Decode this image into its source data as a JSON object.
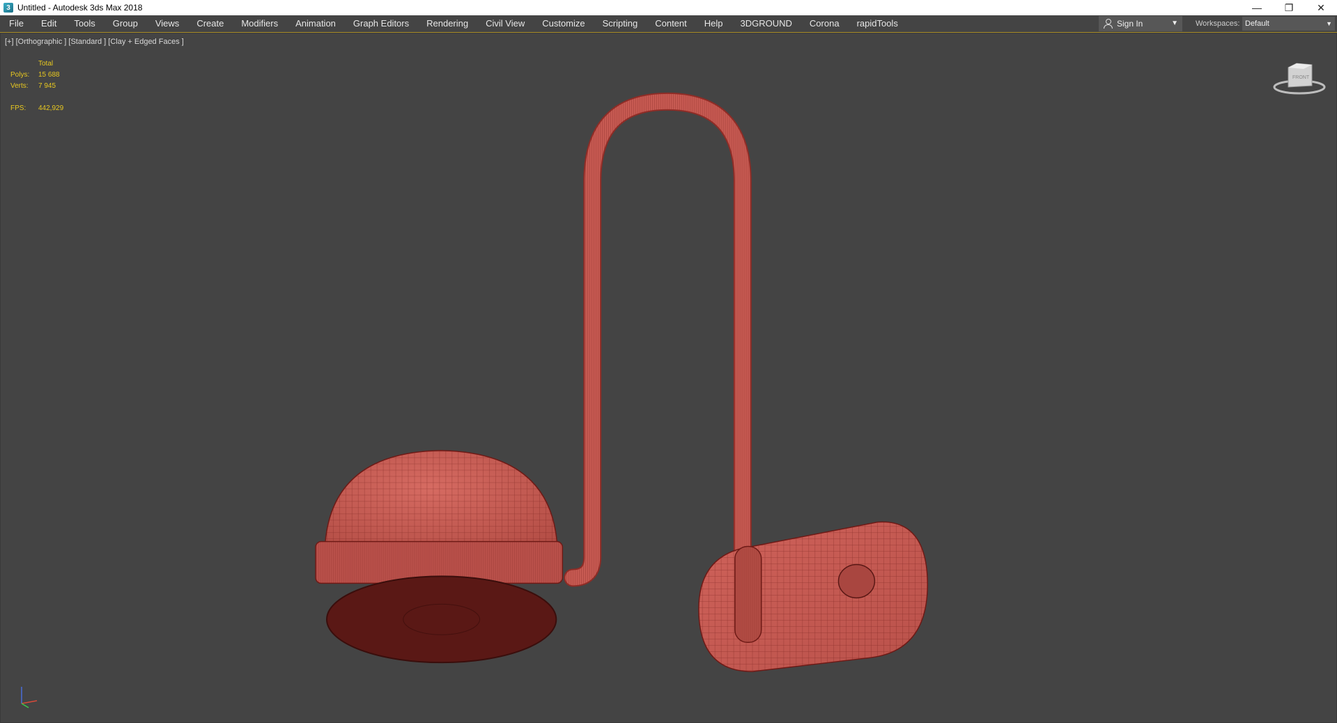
{
  "window": {
    "title": "Untitled - Autodesk 3ds Max 2018",
    "icon": "3dsmax-app-icon",
    "controls": [
      "minimize-icon",
      "restore-icon",
      "close-icon"
    ],
    "glyphs": {
      "minimize": "—",
      "restore": "❐",
      "close": "✕"
    }
  },
  "menu": {
    "items": [
      "File",
      "Edit",
      "Tools",
      "Group",
      "Views",
      "Create",
      "Modifiers",
      "Animation",
      "Graph Editors",
      "Rendering",
      "Civil View",
      "Customize",
      "Scripting",
      "Content",
      "Help",
      "3DGROUND",
      "Corona",
      "rapidTools"
    ]
  },
  "account": {
    "sign_in_label": "Sign In",
    "workspaces_label": "Workspaces:",
    "workspace_value": "Default"
  },
  "viewport": {
    "label": "[+] [Orthographic ] [Standard ] [Clay + Edged Faces ]",
    "stats": {
      "header": "Total",
      "polys_label": "Polys:",
      "polys_value": "15 688",
      "verts_label": "Verts:",
      "verts_value": "7 945",
      "fps_label": "FPS:",
      "fps_value": "442,929"
    },
    "viewcube_face": "FRONT",
    "model_color": "#c75a52",
    "wire_color": "#6e1a16",
    "background_color": "#444444",
    "stats_color": "#e8c820"
  }
}
